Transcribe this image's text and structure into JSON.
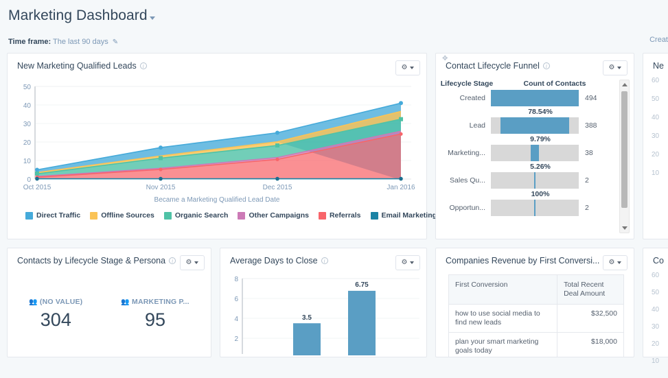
{
  "header": {
    "title": "Marketing Dashboard",
    "caret_icon": "chevron-down-icon",
    "timeframe_label": "Time frame:",
    "timeframe_value": "The last 90 days",
    "edit_icon": "pencil-icon",
    "create_label": "Creat"
  },
  "colors": {
    "accent_blue": "#5a9ec4",
    "direct_traffic": "#45aada",
    "offline_sources": "#fac356",
    "organic_search": "#4fc2a6",
    "other_campaigns": "#cc7ab6",
    "referrals": "#f8656a",
    "email_marketing": "#1b83a5",
    "track_gray": "#d8d8d8"
  },
  "cards": {
    "mql": {
      "title": "New Marketing Qualified Leads",
      "info_icon": "info-icon",
      "gear_icon": "gear-icon"
    },
    "funnel": {
      "title": "Contact Lifecycle Funnel",
      "info_icon": "info-icon",
      "gear_icon": "gear-icon",
      "col_stage": "Lifecycle Stage",
      "col_count": "Count of Contacts",
      "rows": [
        {
          "stage": "Created",
          "count": "494",
          "pct_below": "78.54%",
          "bar_pct": 100,
          "bar_offset": 0
        },
        {
          "stage": "Lead",
          "count": "388",
          "pct_below": "9.79%",
          "bar_pct": 78,
          "bar_offset": 11
        },
        {
          "stage": "Marketing...",
          "count": "38",
          "pct_below": "5.26%",
          "bar_pct": 10,
          "bar_offset": 45
        },
        {
          "stage": "Sales Qu...",
          "count": "2",
          "pct_below": "100%",
          "bar_pct": 2,
          "bar_offset": 49
        },
        {
          "stage": "Opportun...",
          "count": "2",
          "pct_below": "",
          "bar_pct": 2,
          "bar_offset": 49
        }
      ]
    },
    "right_partial_top": {
      "title": "Ne",
      "ticks": [
        "60",
        "50",
        "40",
        "30",
        "20",
        "10"
      ]
    },
    "persona": {
      "title": "Contacts by Lifecycle Stage & Persona",
      "info_icon": "info-icon",
      "gear_icon": "gear-icon",
      "stats": [
        {
          "label": "(NO VALUE)",
          "value": "304",
          "icon": "people-icon"
        },
        {
          "label": "MARKETING P...",
          "value": "95",
          "icon": "people-icon"
        }
      ]
    },
    "avg_days": {
      "title": "Average Days to Close",
      "info_icon": "info-icon",
      "gear_icon": "gear-icon"
    },
    "companies": {
      "title": "Companies Revenue by First Conversi...",
      "gear_icon": "gear-icon",
      "columns": [
        "First Conversion",
        "Total Recent Deal Amount"
      ],
      "rows": [
        [
          "how to use social media to find new leads",
          "$32,500"
        ],
        [
          "plan your smart marketing goals today",
          "$18,000"
        ]
      ]
    },
    "right_partial_bottom": {
      "title": "Co",
      "ticks": [
        "60",
        "50",
        "40",
        "30",
        "20",
        "10"
      ]
    }
  },
  "chart_data": [
    {
      "type": "area",
      "stacked": true,
      "title": "New Marketing Qualified Leads",
      "xlabel": "Became a Marketing Qualified Lead Date",
      "ylabel": "",
      "x": [
        "Oct 2015",
        "Nov 2015",
        "Dec 2015",
        "Jan 2016"
      ],
      "ylim": [
        0,
        50
      ],
      "yticks": [
        0,
        10,
        20,
        30,
        40,
        50
      ],
      "grid": true,
      "legend_position": "bottom",
      "series": [
        {
          "name": "Email Marketing",
          "color": "#1b83a5",
          "values": [
            0.3,
            0.3,
            0.3,
            0.3
          ]
        },
        {
          "name": "Referrals",
          "color": "#f8656a",
          "values": [
            1.2,
            6,
            12,
            23
          ]
        },
        {
          "name": "Other Campaigns",
          "color": "#cc7ab6",
          "values": [
            0.4,
            0.6,
            1,
            1.5
          ]
        },
        {
          "name": "Organic Search",
          "color": "#4fc2a6",
          "values": [
            1.4,
            5.5,
            6.5,
            6.5
          ]
        },
        {
          "name": "Offline Sources",
          "color": "#fac356",
          "values": [
            0.7,
            1.2,
            2,
            4.2
          ]
        },
        {
          "name": "Direct Traffic",
          "color": "#45aada",
          "values": [
            1.5,
            4.5,
            4.5,
            5.5
          ]
        }
      ],
      "point_totals": [
        5,
        17,
        25,
        41
      ]
    },
    {
      "type": "bar",
      "title": "Average Days to Close",
      "categories": [
        "",
        ""
      ],
      "values": [
        3.5,
        6.75
      ],
      "data_labels": [
        "3.5",
        "6.75"
      ],
      "ylim": [
        0,
        8
      ],
      "yticks": [
        2,
        4,
        6,
        8
      ],
      "grid": true,
      "color": "#5a9ec4"
    },
    {
      "type": "bar",
      "title": "Contact Lifecycle Funnel",
      "categories": [
        "Created",
        "Lead",
        "Marketing...",
        "Sales Qu...",
        "Opportun..."
      ],
      "values": [
        494,
        388,
        38,
        2,
        2
      ],
      "conversion_rates": [
        "78.54%",
        "9.79%",
        "5.26%",
        "100%"
      ],
      "xlabel": "Count of Contacts",
      "ylabel": "Lifecycle Stage",
      "color": "#5a9ec4"
    },
    {
      "type": "table",
      "title": "Companies Revenue by First Conversi...",
      "columns": [
        "First Conversion",
        "Total Recent Deal Amount"
      ],
      "rows": [
        [
          "how to use social media to find new leads",
          "$32,500"
        ],
        [
          "plan your smart marketing goals today",
          "$18,000"
        ]
      ]
    }
  ]
}
